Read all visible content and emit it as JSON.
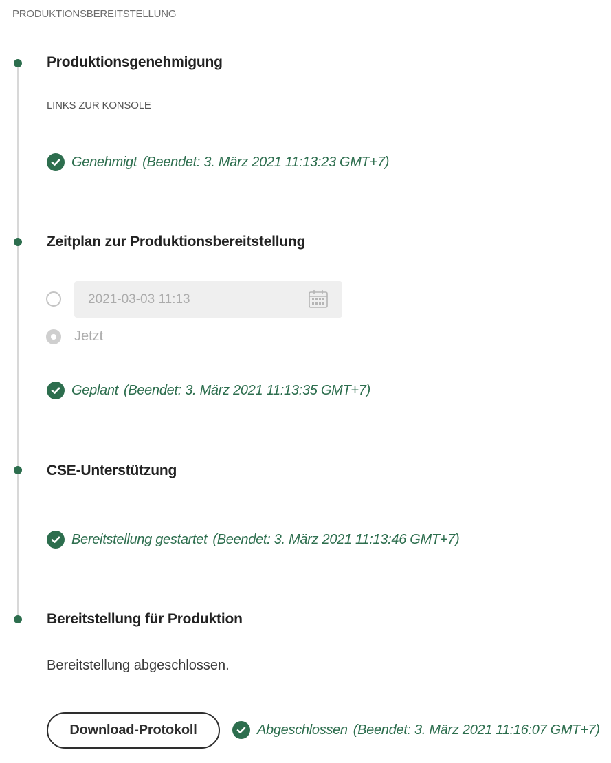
{
  "heading": "PRODUKTIONSBEREITSTELLUNG",
  "steps": [
    {
      "title": "Produktionsgenehmigung",
      "subheading": "LINKS ZUR KONSOLE",
      "status": "Genehmigt",
      "status_detail": "(Beendet: 3. März 2021 11:13:23 GMT+7)"
    },
    {
      "title": "Zeitplan zur Produktionsbereitstellung",
      "date_value": "2021-03-03 11:13",
      "now_label": "Jetzt",
      "status": "Geplant",
      "status_detail": "(Beendet: 3. März 2021 11:13:35 GMT+7)"
    },
    {
      "title": "CSE-Unterstützung",
      "status": "Bereitstellung gestartet",
      "status_detail": "(Beendet: 3. März 2021 11:13:46 GMT+7)"
    },
    {
      "title": "Bereitstellung für Produktion",
      "message": "Bereitstellung abgeschlossen.",
      "button_label": "Download-Protokoll",
      "status": "Abgeschlossen",
      "status_detail": "(Beendet: 3. März 2021 11:16:07 GMT+7)"
    }
  ],
  "icons": {
    "check": "check-circle-icon",
    "calendar": "calendar-icon"
  },
  "colors": {
    "success": "#2d6e4e",
    "timeline_line": "#d8d8d8",
    "disabled_text": "#ababab"
  }
}
